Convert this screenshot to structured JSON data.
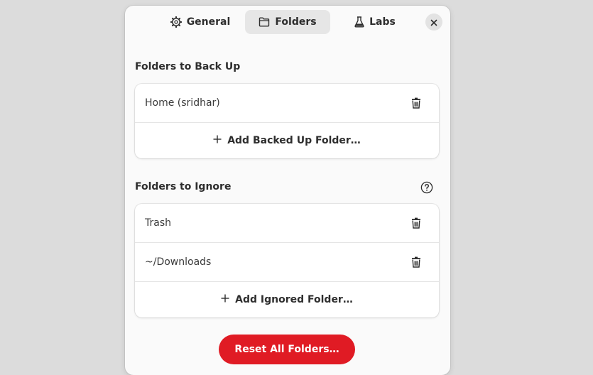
{
  "header": {
    "tabs": [
      {
        "label": "General",
        "icon": "gear-icon"
      },
      {
        "label": "Folders",
        "icon": "folder-icon",
        "active": true
      },
      {
        "label": "Labs",
        "icon": "flask-icon"
      }
    ]
  },
  "backup": {
    "title": "Folders to Back Up",
    "folders": [
      "Home (sridhar)"
    ],
    "add_label": "Add Backed Up Folder…"
  },
  "ignore": {
    "title": "Folders to Ignore",
    "folders": [
      "Trash",
      "~/Downloads"
    ],
    "add_label": "Add Ignored Folder…"
  },
  "reset_label": "Reset All Folders…",
  "colors": {
    "accent_destructive": "#e01b24",
    "background": "#dcdcdc",
    "dialog": "#fafafa",
    "active_tab": "#e6e6e6"
  }
}
